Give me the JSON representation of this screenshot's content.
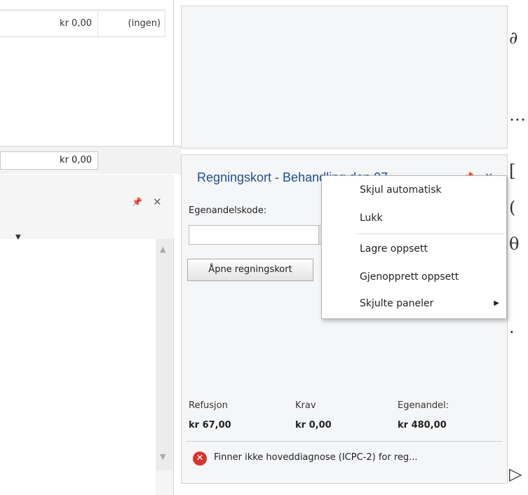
{
  "grid": {
    "row": {
      "amount": "kr 0,00",
      "ref": "(ingen)"
    },
    "total": "kr 0,00"
  },
  "left_panel": {
    "pin_icon": "pin-icon",
    "close_icon": "close-icon",
    "dropdown_icon": "chevron-down-icon"
  },
  "billing": {
    "title": "Regningskort - Behandling den 07...",
    "code_label": "Egenandelskode:",
    "code_value": "",
    "open_button": "Åpne regningskort",
    "refusjon_label": "Refusjon",
    "refusjon_value": "kr 67,00",
    "krav_label": "Krav",
    "krav_value": "kr 0,00",
    "egenandel_label": "Egenandel:",
    "egenandel_value": "kr 480,00",
    "error_text": "Finner ikke hoveddiagnose (ICPC-2) for reg..."
  },
  "context_menu": {
    "items": [
      "Skjul automatisk",
      "Lukk",
      "Lagre oppsett",
      "Gjenopprett oppsett",
      "Skjulte paneler"
    ]
  },
  "colors": {
    "title_blue": "#1f4e8c",
    "error_red": "#d9342b",
    "panel_bg": "#f5f6f8"
  }
}
